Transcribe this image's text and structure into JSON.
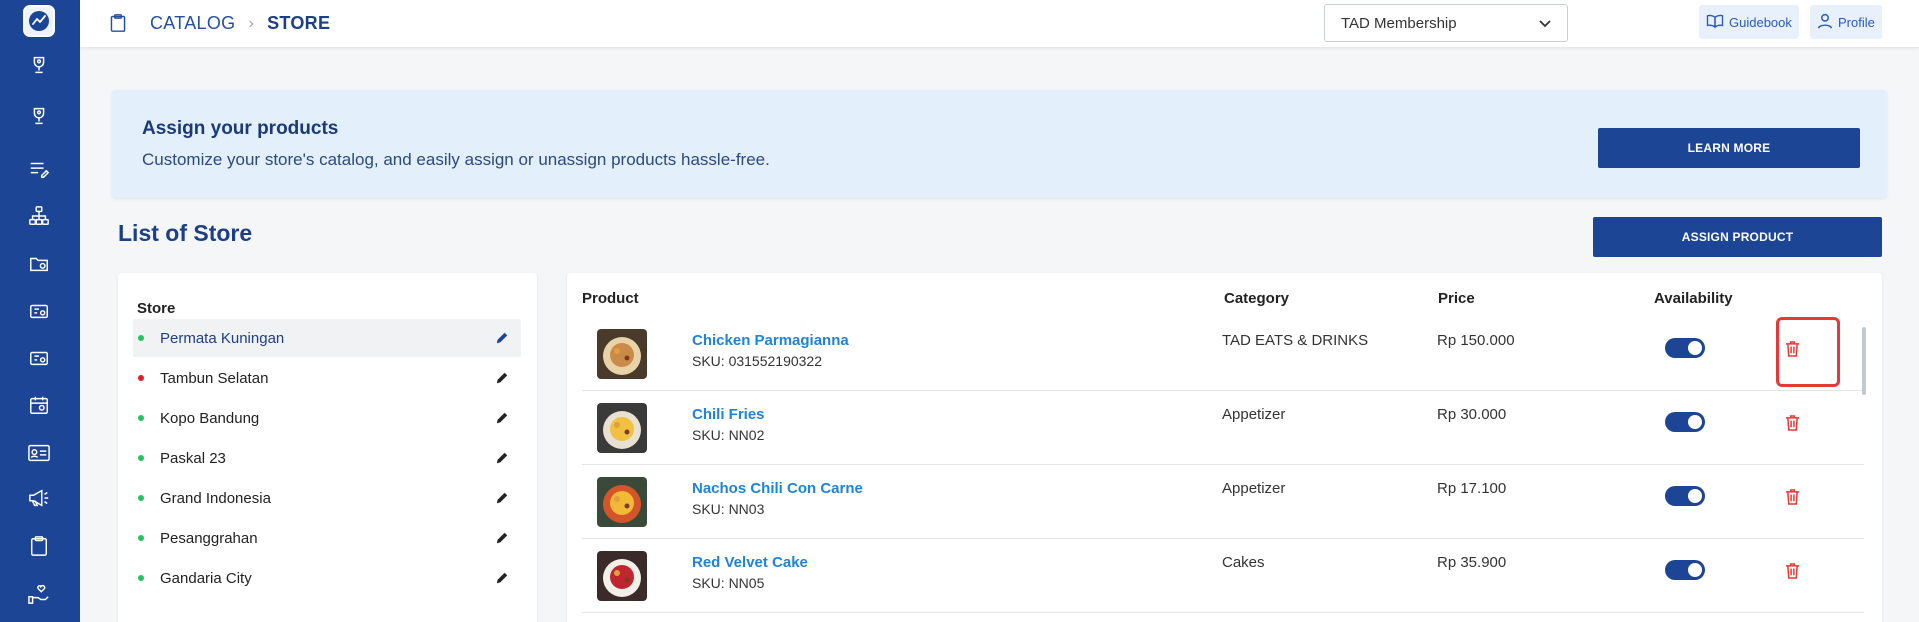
{
  "header": {
    "breadcrumb": [
      "CATALOG",
      "STORE"
    ],
    "select_value": "TAD Membership",
    "guidebook_label": "Guidebook",
    "profile_label": "Profile"
  },
  "banner": {
    "title": "Assign your products",
    "subtitle": "Customize your store's catalog, and easily assign or unassign products hassle-free.",
    "learn_more_label": "LEARN MORE"
  },
  "list_title": "List of Store",
  "assign_product_label": "ASSIGN PRODUCT",
  "stores": {
    "header": "Store",
    "items": [
      {
        "name": "Permata Kuningan",
        "status": "active",
        "selected": true
      },
      {
        "name": "Tambun Selatan",
        "status": "inactive",
        "selected": false
      },
      {
        "name": "Kopo Bandung",
        "status": "active",
        "selected": false
      },
      {
        "name": "Paskal 23",
        "status": "active",
        "selected": false
      },
      {
        "name": "Grand Indonesia",
        "status": "active",
        "selected": false
      },
      {
        "name": "Pesanggrahan",
        "status": "active",
        "selected": false
      },
      {
        "name": "Gandaria City",
        "status": "active",
        "selected": false
      }
    ]
  },
  "products": {
    "columns": {
      "product": "Product",
      "category": "Category",
      "price": "Price",
      "availability": "Availability"
    },
    "rows": [
      {
        "name": "Chicken Parmagianna",
        "sku": "SKU: 031552190322",
        "category": "TAD EATS & DRINKS",
        "price": "Rp 150.000",
        "available": true
      },
      {
        "name": "Chili Fries",
        "sku": "SKU: NN02",
        "category": "Appetizer",
        "price": "Rp 30.000",
        "available": true
      },
      {
        "name": "Nachos Chili Con Carne",
        "sku": "SKU: NN03",
        "category": "Appetizer",
        "price": "Rp 17.100",
        "available": true
      },
      {
        "name": "Red Velvet Cake",
        "sku": "SKU: NN05",
        "category": "Cakes",
        "price": "Rp 35.900",
        "available": true
      }
    ]
  },
  "colors": {
    "brand": "#1d4596",
    "status_active": "#22c55e",
    "status_inactive": "#e11d2a",
    "link": "#1f83d6",
    "danger": "#e53935"
  },
  "sidebar_icons": [
    "trophy-icon",
    "trophy-icon",
    "list-edit-icon",
    "org-chart-icon",
    "folder-settings-icon",
    "ticket-settings-icon",
    "ticket-settings-icon",
    "calendar-icon",
    "id-card-icon",
    "megaphone-icon",
    "clipboard-icon",
    "hand-heart-icon"
  ]
}
